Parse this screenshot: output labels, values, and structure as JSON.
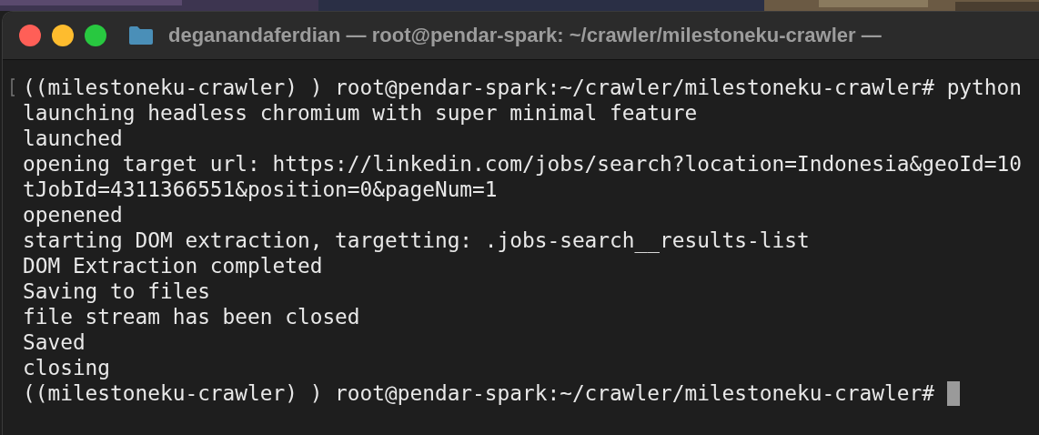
{
  "window": {
    "title": "deganandaferdian — root@pendar-spark: ~/crawler/milestoneku-crawler —"
  },
  "terminal": {
    "lines": [
      {
        "text": "((milestoneku-crawler) ) root@pendar-spark:~/crawler/milestoneku-crawler# python",
        "marked": true,
        "cursor": false
      },
      {
        "text": "launching headless chromium with super minimal feature",
        "marked": false,
        "cursor": false
      },
      {
        "text": "launched",
        "marked": false,
        "cursor": false
      },
      {
        "text": "opening target url: https://linkedin.com/jobs/search?location=Indonesia&geoId=10",
        "marked": false,
        "cursor": false
      },
      {
        "text": "tJobId=4311366551&position=0&pageNum=1",
        "marked": false,
        "cursor": false
      },
      {
        "text": "openened",
        "marked": false,
        "cursor": false
      },
      {
        "text": "starting DOM extraction, targetting: .jobs-search__results-list",
        "marked": false,
        "cursor": false
      },
      {
        "text": "DOM Extraction completed",
        "marked": false,
        "cursor": false
      },
      {
        "text": "Saving to files",
        "marked": false,
        "cursor": false
      },
      {
        "text": "file stream has been closed",
        "marked": false,
        "cursor": false
      },
      {
        "text": "Saved",
        "marked": false,
        "cursor": false
      },
      {
        "text": "closing",
        "marked": false,
        "cursor": false
      },
      {
        "text": "((milestoneku-crawler) ) root@pendar-spark:~/crawler/milestoneku-crawler# ",
        "marked": false,
        "cursor": true
      }
    ]
  }
}
